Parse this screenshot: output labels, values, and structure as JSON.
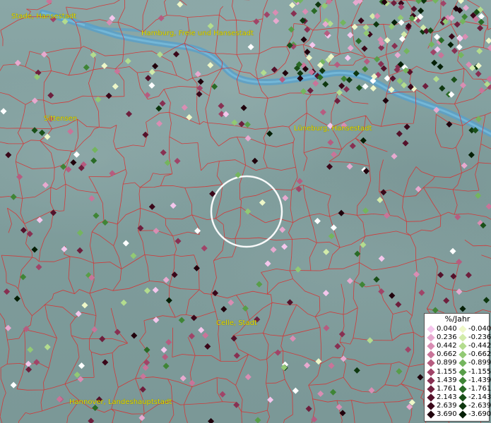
{
  "map": {
    "cities": [
      {
        "name": "Stade, Hansestadt"
      },
      {
        "name": "Hamburg, Freie und Hansestadt"
      },
      {
        "name": "Sittensen"
      },
      {
        "name": "Lüneburg, Hansestadt"
      },
      {
        "name": "Celle, Stadt"
      },
      {
        "name": "Hannover, Landeshauptstadt"
      }
    ]
  },
  "legend": {
    "title": "%/Jahr",
    "positive": [
      {
        "value": "0.040",
        "color": "#f4c6ec"
      },
      {
        "value": "0.236",
        "color": "#e7a9cf"
      },
      {
        "value": "0.442",
        "color": "#d98db3"
      },
      {
        "value": "0.662",
        "color": "#c97499"
      },
      {
        "value": "0.899",
        "color": "#b65c80"
      },
      {
        "value": "1.155",
        "color": "#a04468"
      },
      {
        "value": "1.439",
        "color": "#883052"
      },
      {
        "value": "1.761",
        "color": "#6e1f3d"
      },
      {
        "value": "2.143",
        "color": "#54112a"
      },
      {
        "value": "2.639",
        "color": "#3a0719"
      },
      {
        "value": "3.690",
        "color": "#20020c"
      }
    ],
    "negative": [
      {
        "value": "-0.040",
        "color": "#eef7c8"
      },
      {
        "value": "-0.236",
        "color": "#d2ebaa"
      },
      {
        "value": "-0.442",
        "color": "#b3dc8e"
      },
      {
        "value": "-0.662",
        "color": "#92c974"
      },
      {
        "value": "-0.899",
        "color": "#74b55e"
      },
      {
        "value": "-1.155",
        "color": "#589e49"
      },
      {
        "value": "-1.439",
        "color": "#3f8536"
      },
      {
        "value": "-1.761",
        "color": "#2a6b26"
      },
      {
        "value": "-2.143",
        "color": "#1a5019"
      },
      {
        "value": "-2.639",
        "color": "#0e370f"
      },
      {
        "value": "-3.690",
        "color": "#051f06"
      }
    ]
  }
}
